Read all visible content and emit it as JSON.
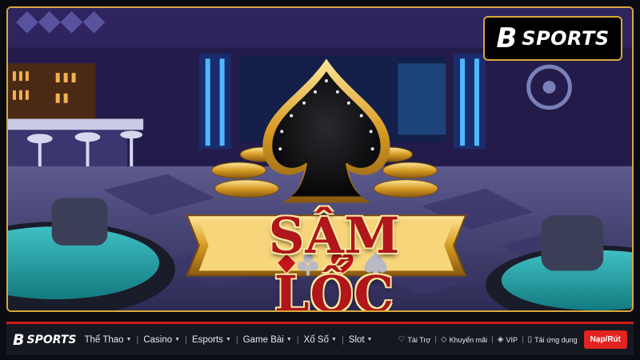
{
  "hero": {
    "title": "SÂM LỐC",
    "brand": {
      "mark": "B",
      "name": "SPORTS"
    },
    "suits": [
      "diamond-icon",
      "club-icon",
      "heart-icon",
      "spade-icon"
    ]
  },
  "navbar": {
    "brand": {
      "mark": "B",
      "name": "SPORTS"
    },
    "menu": [
      {
        "label": "Thể Thao"
      },
      {
        "label": "Casino"
      },
      {
        "label": "Esports"
      },
      {
        "label": "Game Bài"
      },
      {
        "label": "Xổ Số"
      },
      {
        "label": "Slot"
      }
    ],
    "utilities": [
      {
        "label": "Tài Trợ",
        "icon": "sponsor-icon"
      },
      {
        "label": "Khuyến mãi",
        "icon": "promo-tag-icon"
      },
      {
        "label": "VIP",
        "icon": "diamond-icon"
      },
      {
        "label": "Tải ứng dụng",
        "icon": "mobile-app-icon"
      }
    ],
    "cta_label": "Nạp/Rút"
  },
  "colors": {
    "accent": "#e32222",
    "gold": "#d8a93a",
    "nav_bg": "#151821"
  }
}
